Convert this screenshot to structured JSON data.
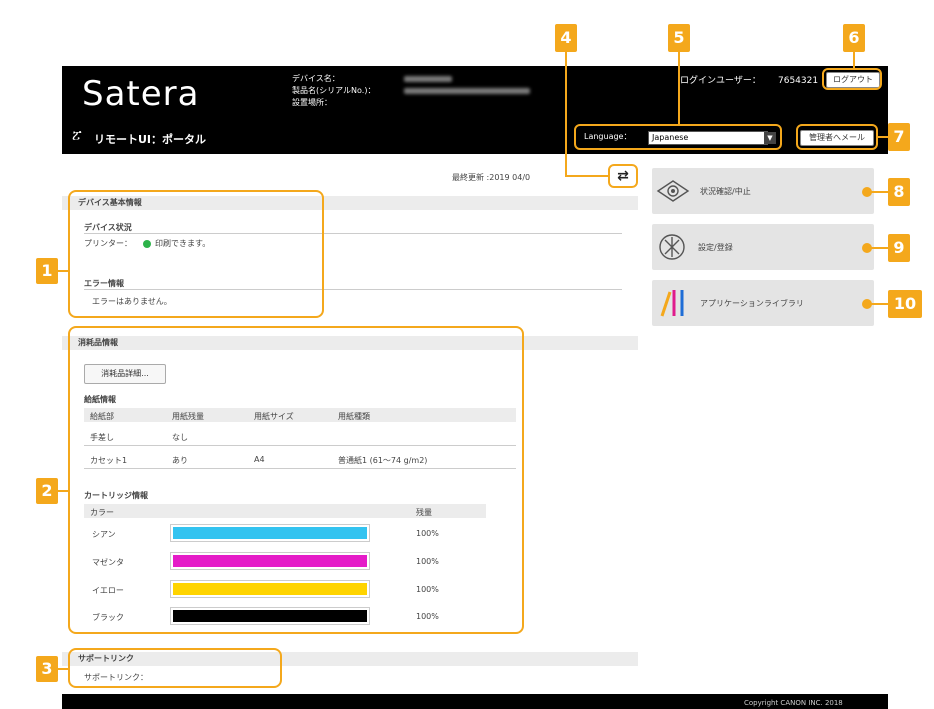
{
  "header": {
    "logo": "Satera",
    "device_name_label": "デバイス名：",
    "product_name_label": "製品名(シリアルNo.)：",
    "location_label": "設置場所：",
    "login_user_label": "ログインユーザー：",
    "login_user_value": "7654321",
    "logout_label": "ログアウト",
    "title": "リモートUI：ポータル",
    "language_label": "Language：",
    "language_value": "Japanese",
    "mail_admin_label": "管理者へメール"
  },
  "last_updated": "最終更新 :2019 04/0",
  "device_info": {
    "section_title": "デバイス基本情報",
    "status_heading": "デバイス状況",
    "printer_label": "プリンター：",
    "printer_status": "印刷できます。",
    "status_color": "#2db34a",
    "error_heading": "エラー情報",
    "error_text": "エラーはありません。"
  },
  "consumables": {
    "section_title": "消耗品情報",
    "details_button": "消耗品詳細...",
    "paper_heading": "給紙情報",
    "paper_columns": [
      "給紙部",
      "用紙残量",
      "用紙サイズ",
      "用紙種類"
    ],
    "paper_rows": [
      [
        "手差し",
        "なし",
        "",
        ""
      ],
      [
        "カセット1",
        "あり",
        "A4",
        "普通紙1 (61〜74 g/m2)"
      ]
    ],
    "cartridge_heading": "カートリッジ情報",
    "cartridge_columns": [
      "カラー",
      "",
      "残量"
    ],
    "cartridges": [
      {
        "name": "シアン",
        "level": "100%",
        "color": "#33c3f0"
      },
      {
        "name": "マゼンタ",
        "level": "100%",
        "color": "#e51cc8"
      },
      {
        "name": "イエロー",
        "level": "100%",
        "color": "#ffd400"
      },
      {
        "name": "ブラック",
        "level": "100%",
        "color": "#000000"
      }
    ]
  },
  "support": {
    "section_title": "サポートリンク",
    "link_label": "サポートリンク："
  },
  "right_menu": [
    {
      "label": "状況確認/中止",
      "icon": "eye-icon"
    },
    {
      "label": "設定/登録",
      "icon": "settings-icon"
    },
    {
      "label": "アプリケーションライブラリ",
      "icon": "app-library-icon"
    }
  ],
  "callouts": [
    "1",
    "2",
    "3",
    "4",
    "5",
    "6",
    "7",
    "8",
    "9",
    "10"
  ],
  "footer": {
    "copyright": "Copyright CANON INC. 2018"
  },
  "colors": {
    "accent": "#f4a81c",
    "header_bg": "#000000"
  }
}
